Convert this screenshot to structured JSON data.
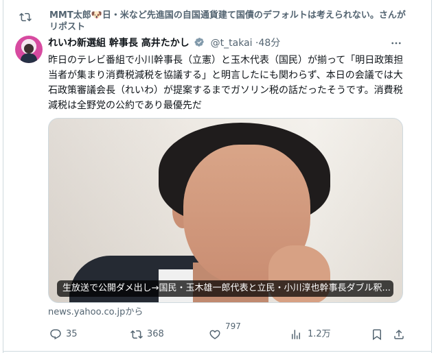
{
  "repost": {
    "text": "MMT太郎🐶日・米など先進国の自国通貨建て国債のデフォルトは考えられない。さんがリポスト",
    "icon": "repost-icon"
  },
  "tweet": {
    "author_name": "れいわ新選組 幹事長 高井たかし",
    "handle": "@t_takai",
    "separator": "·",
    "time": "48分",
    "body": "昨日のテレビ番組で小川幹事長（立憲）と玉木代表（国民）が揃って「明日政策担当者が集まり消費税減税を協議する」と明言したにも関わらず、本日の会議では大石政策審議会長（れいわ）が提案するまでガソリン税の話だったそうです。消費税減税は全野党の公約であり最優先だ",
    "media_caption": "生放送で公開ダメ出し→国民・玉木雄一郎代表と立民・小川淳也幹事長ダブル釈...",
    "source_link": "news.yahoo.co.jpから"
  },
  "actions": {
    "reply_count": "35",
    "retweet_count": "368",
    "like_count": "797",
    "views_count": "1.2万"
  },
  "colors": {
    "text_primary": "#0f1419",
    "text_secondary": "#536471",
    "verified_badge": "#829aab",
    "border": "#cfd9de"
  },
  "icons": [
    "repost-icon",
    "verified-badge-icon",
    "more-icon",
    "reply-icon",
    "retweet-icon",
    "like-icon",
    "views-icon",
    "bookmark-icon",
    "share-icon"
  ]
}
